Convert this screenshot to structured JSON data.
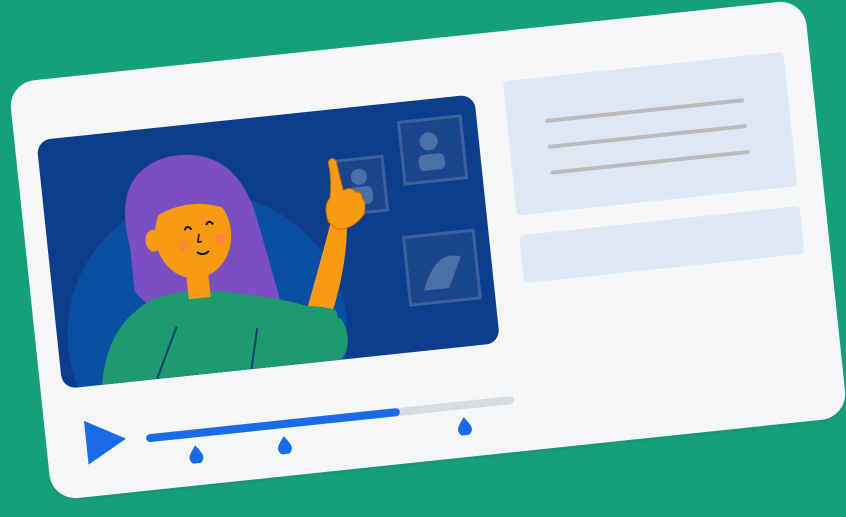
{
  "player": {
    "progress": 0.69,
    "markers": [
      0.13,
      0.37,
      0.86
    ]
  },
  "colors": {
    "background": "#16a07a",
    "card": "#f4f6f7",
    "video_bg": "#0d3e8d",
    "accent_blue": "#1a6ce6",
    "panel": "#dde7f6",
    "hair": "#7a4fc2",
    "skin": "#f79a14",
    "shirt": "#1e9b6e"
  },
  "icons": {
    "play": "play-icon",
    "marker": "drop-marker-icon"
  }
}
